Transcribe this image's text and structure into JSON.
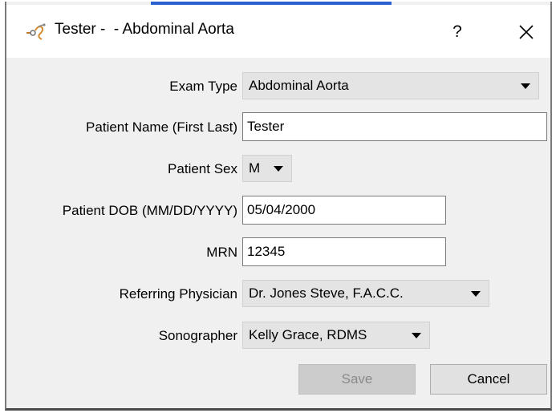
{
  "window": {
    "title": "Tester -  - Abdominal Aorta",
    "help_label": "?"
  },
  "form": {
    "exam_type": {
      "label": "Exam Type",
      "value": "Abdominal Aorta"
    },
    "patient_name": {
      "label": "Patient Name (First Last)",
      "value": "Tester"
    },
    "patient_sex": {
      "label": "Patient Sex",
      "value": "M"
    },
    "patient_dob": {
      "label": "Patient DOB (MM/DD/YYYY)",
      "value": "05/04/2000"
    },
    "mrn": {
      "label": "MRN",
      "value": "12345"
    },
    "referring_physician": {
      "label": "Referring Physician",
      "value": "Dr. Jones Steve, F.A.C.C."
    },
    "sonographer": {
      "label": "Sonographer",
      "value": "Kelly Grace, RDMS"
    }
  },
  "buttons": {
    "save": "Save",
    "cancel": "Cancel"
  },
  "icons": {
    "app": "stethoscope-app-icon",
    "help": "help-icon",
    "close": "close-icon",
    "dropdown": "chevron-down-icon"
  },
  "colors": {
    "accent": "#2a5fd0",
    "dialog_background": "#f0f0f0",
    "disabled_button": "#cccccc"
  }
}
